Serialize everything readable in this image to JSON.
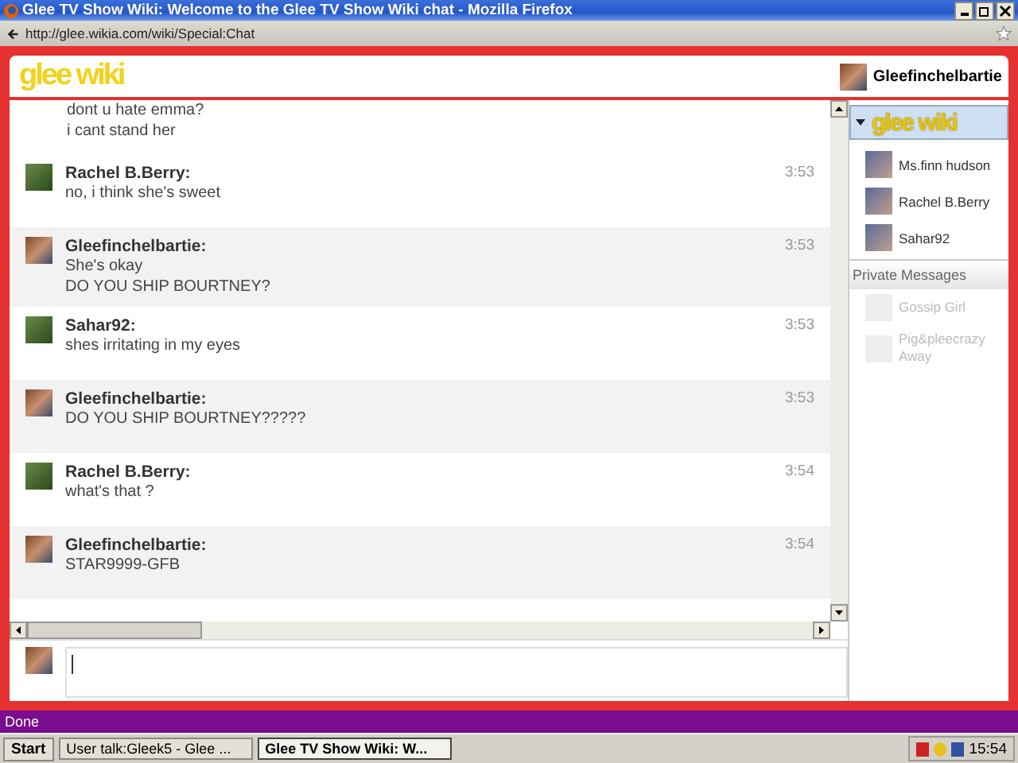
{
  "window": {
    "title": "Glee TV Show Wiki: Welcome to the Glee TV Show Wiki chat - Mozilla Firefox",
    "address": "http://glee.wikia.com/wiki/Special:Chat"
  },
  "header": {
    "logo": "glee wiki",
    "user": "Gleefinchelbartie"
  },
  "messages": [
    {
      "own": false,
      "lines": [
        "dont u hate emma?",
        "i cant stand her"
      ]
    },
    {
      "own": false,
      "name": "Rachel B.Berry:",
      "time": "3:53",
      "lines": [
        "no, i think she's sweet"
      ]
    },
    {
      "own": true,
      "name": "Gleefinchelbartie:",
      "time": "3:53",
      "lines": [
        "She's okay",
        "DO YOU SHIP BOURTNEY?"
      ]
    },
    {
      "own": false,
      "name": "Sahar92:",
      "time": "3:53",
      "lines": [
        "shes irritating in my eyes"
      ]
    },
    {
      "own": true,
      "name": "Gleefinchelbartie:",
      "time": "3:53",
      "lines": [
        "DO YOU SHIP BOURTNEY?????"
      ]
    },
    {
      "own": false,
      "name": "Rachel B.Berry:",
      "time": "3:54",
      "lines": [
        "what's that ?"
      ]
    },
    {
      "own": true,
      "name": "Gleefinchelbartie:",
      "time": "3:54",
      "lines": [
        "STAR9999-GFB"
      ]
    }
  ],
  "sidebar": {
    "room": "glee wiki",
    "users": [
      {
        "name": "Ms.finn hudson"
      },
      {
        "name": "Rachel B.Berry"
      },
      {
        "name": "Sahar92"
      }
    ],
    "private_heading": "Private Messages",
    "private": [
      {
        "name": "Gossip Girl",
        "away": true
      },
      {
        "name": "Pig&pleecrazy Away",
        "away": true
      }
    ]
  },
  "status_bar": "Done",
  "taskbar": {
    "start": "Start",
    "tasks": [
      {
        "label": "User talk:Gleek5 - Glee ...",
        "selected": false
      },
      {
        "label": "Glee TV Show Wiki: W...",
        "selected": true
      }
    ],
    "clock": "15:54"
  }
}
